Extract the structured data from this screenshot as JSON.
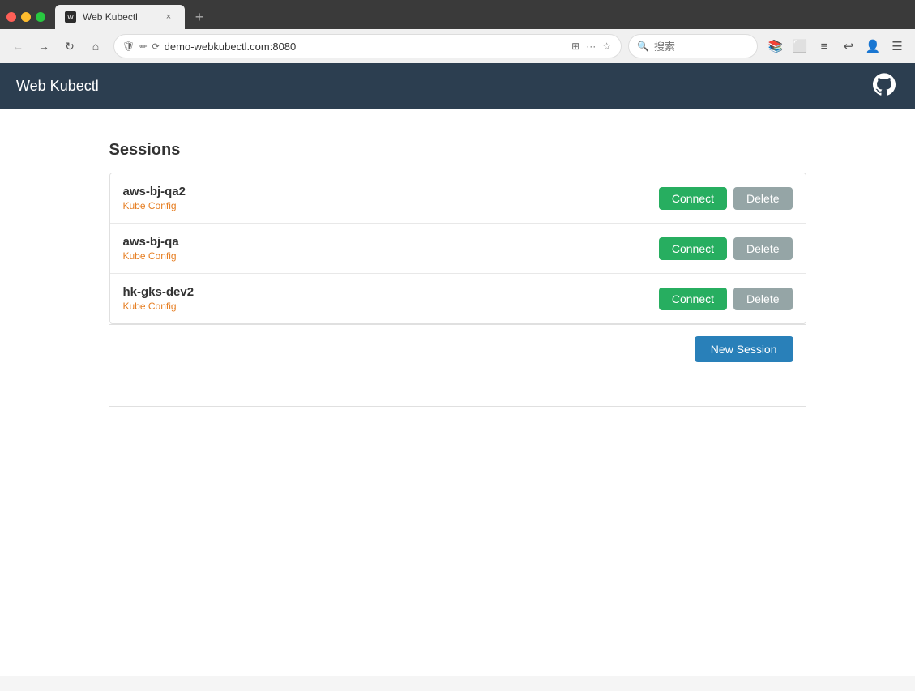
{
  "browser": {
    "tab_title": "Web Kubectl",
    "url": "demo-webkubectl.com:8080",
    "search_placeholder": "搜索",
    "new_tab_label": "+",
    "tab_close_label": "×"
  },
  "nav": {
    "back_label": "←",
    "forward_label": "→",
    "refresh_label": "↻",
    "home_label": "⌂",
    "more_label": "···",
    "bookmark_label": "☆",
    "qr_label": "⊞"
  },
  "toolbar": {
    "library_label": "📚",
    "screenshot_label": "□",
    "reader_label": "≡",
    "undo_label": "↩",
    "profile_label": "👤",
    "menu_label": "☰"
  },
  "app": {
    "title": "Web Kubectl",
    "github_icon": "⊙"
  },
  "sessions": {
    "title": "Sessions",
    "new_session_label": "New Session",
    "items": [
      {
        "name": "aws-bj-qa2",
        "type": "Kube Config",
        "connect_label": "Connect",
        "delete_label": "Delete"
      },
      {
        "name": "aws-bj-qa",
        "type": "Kube Config",
        "connect_label": "Connect",
        "delete_label": "Delete"
      },
      {
        "name": "hk-gks-dev2",
        "type": "Kube Config",
        "connect_label": "Connect",
        "delete_label": "Delete"
      }
    ]
  }
}
